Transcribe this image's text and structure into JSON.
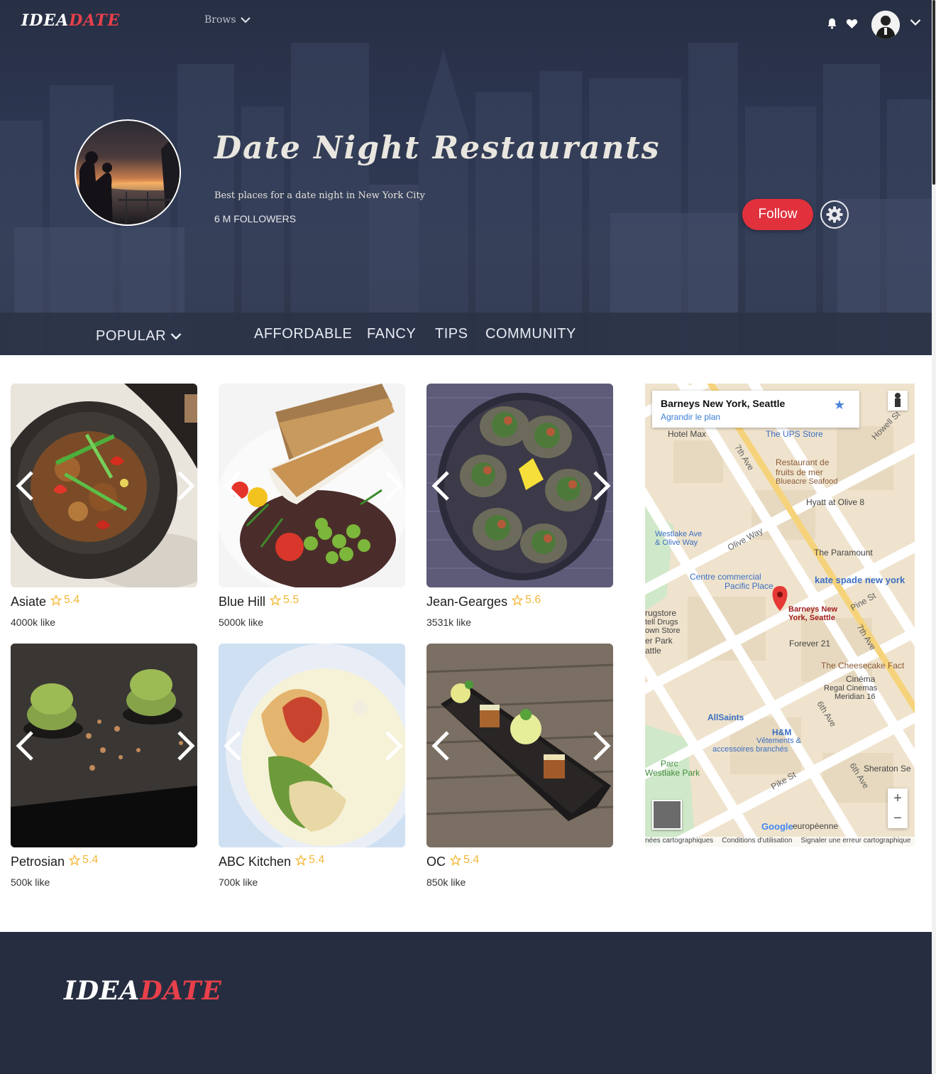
{
  "brand": {
    "part1": "IDEA",
    "part2": "DATE"
  },
  "nav": {
    "browse": "Brows"
  },
  "hero": {
    "title": "Date Night Restaurants",
    "subtitle": "Best places for a date night in New York City",
    "followers": "6 M FOLLOWERS",
    "follow_label": "Follow"
  },
  "tabs": [
    "POPULAR",
    "AFFORDABLE",
    "FANCY",
    "TIPS",
    "COMMUNITY"
  ],
  "restaurants": [
    {
      "name": "Asiate",
      "rating": "5.4",
      "likes": "4000k like"
    },
    {
      "name": "Blue Hill",
      "rating": "5.5",
      "likes": "5000k like"
    },
    {
      "name": "Jean-Gearges",
      "rating": "5.6",
      "likes": "3531k like"
    },
    {
      "name": "Petrosian",
      "rating": "5.4",
      "likes": "500k like"
    },
    {
      "name": "ABC Kitchen",
      "rating": "5.4",
      "likes": "700k like"
    },
    {
      "name": "OC",
      "rating": "5.4",
      "likes": "850k like"
    }
  ],
  "map": {
    "place_title": "Barneys New York, Seattle",
    "enlarge_link": "Agrandir le plan",
    "labels": {
      "hotel_max": "Hotel Max",
      "ups": "The UPS Store",
      "seafood1": "Restaurant de",
      "seafood2": "fruits de mer",
      "seafood3": "Blueacre Seafood",
      "hyatt": "Hyatt at Olive 8",
      "westlake1": "Westlake Ave",
      "westlake2": "& Olive Way",
      "olive_way": "Olive Way",
      "paramount": "The Paramount",
      "pacific1": "Centre commercial",
      "pacific2": "Pacific Place",
      "kate": "kate spade new york",
      "barneys1": "Barneys New",
      "barneys2": "York, Seattle",
      "forever": "Forever 21",
      "cheesecake": "The Cheesecake Fact",
      "cinema1": "Cinéma",
      "cinema2": "Regal Cinemas",
      "cinema3": "Meridian 16",
      "allsaints": "AllSaints",
      "hm1": "H&M",
      "hm2": "Vêtements &",
      "hm3": "accessoires branchés",
      "park1": "Parc",
      "park2": "Westlake Park",
      "sheraton": "Sheraton Se",
      "pike": "Pike St",
      "europeenne": "européenne",
      "ave7": "7th Ave",
      "ave6": "6th Ave",
      "pine": "Pine St",
      "howell": "Howell St",
      "drugstore1": "rugstore",
      "drugstore2": "tell Drugs",
      "drugstore3": "own Store",
      "drugstore4": "er Park",
      "drugstore5": "attle"
    },
    "footer": [
      "nées cartographiques",
      "Conditions d'utilisation",
      "Signaler une erreur cartographique"
    ],
    "google": "Google"
  },
  "colors": {
    "accent": "#e0313d",
    "brand_red": "#e8404b",
    "star": "#f4b83a",
    "navy": "#262d40"
  }
}
